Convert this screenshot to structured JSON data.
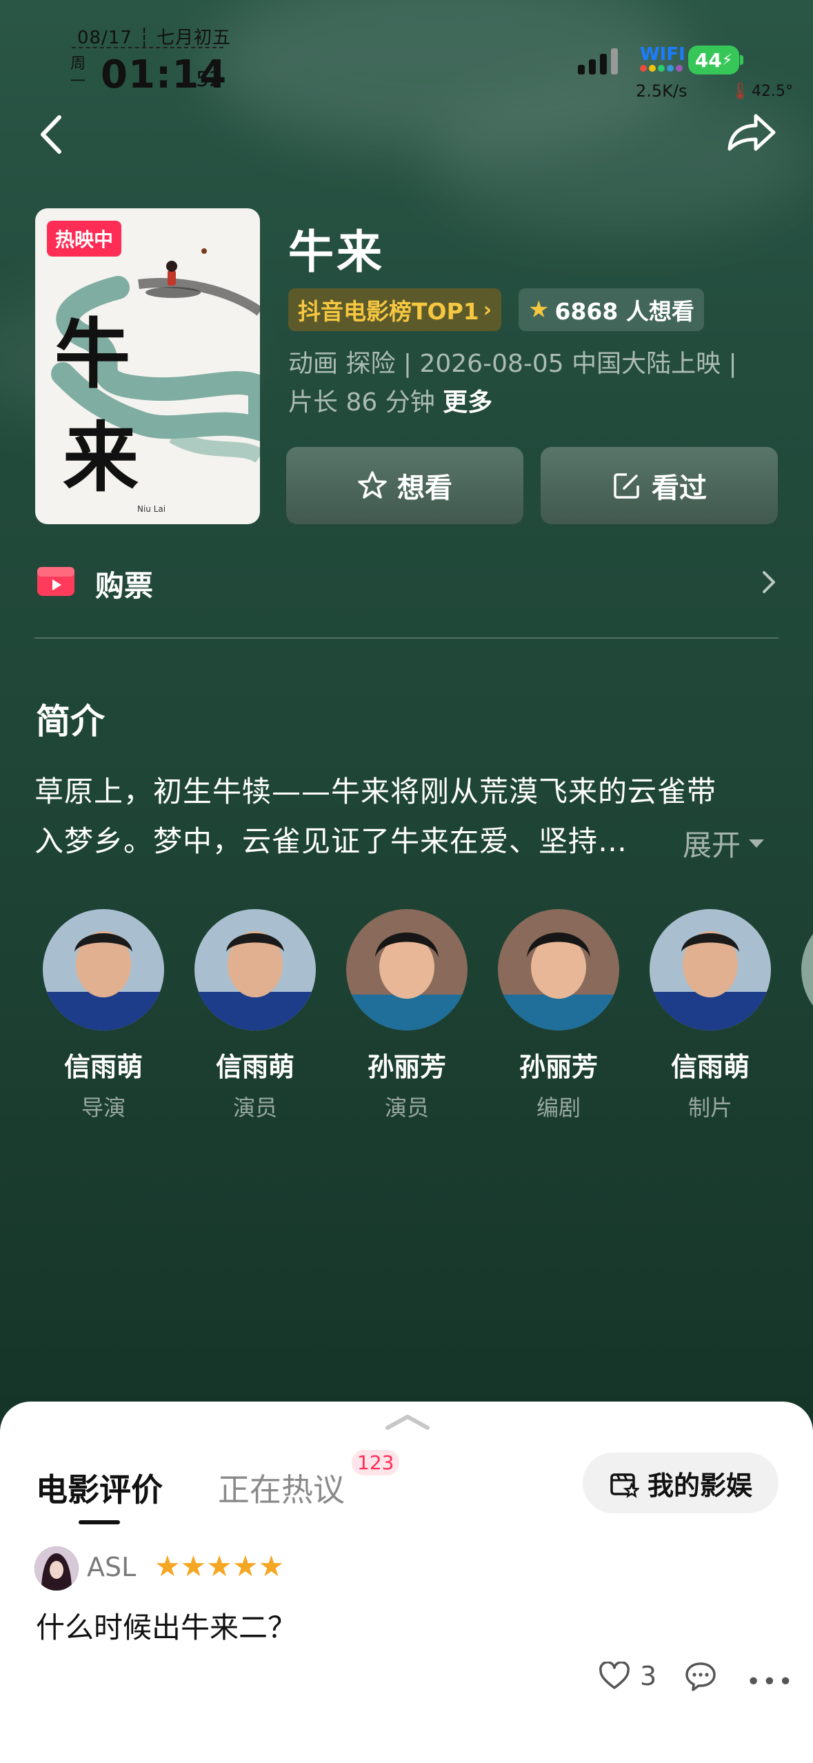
{
  "status_bar": {
    "date": "08/17 ┆ 七月初五",
    "weekday": "周一",
    "time": "01:14",
    "seconds": "52",
    "wifi_label": "WIFI",
    "battery": "44",
    "net_speed": "2.5K/s",
    "temperature": "42.5°"
  },
  "nav": {
    "back_icon": "chevron-left-icon",
    "share_icon": "share-arrow-icon"
  },
  "movie": {
    "status_badge": "热映中",
    "title": "牛来",
    "rank_badge": "抖音电影榜TOP1",
    "want_count": "6868 人想看",
    "meta_line1": "动画 探险 | 2026-08-05 中国大陆上映 |",
    "meta_line2_prefix": "片长 86 分钟",
    "meta_more": "更多",
    "poster_calligraphy": "牛来",
    "poster_caption": "Niu Lai"
  },
  "actions": {
    "want_label": "想看",
    "seen_label": "看过"
  },
  "buy": {
    "label": "购票"
  },
  "intro": {
    "heading": "简介",
    "line1": "草原上，初生牛犊——牛来将刚从荒漠飞来的云雀带",
    "line2": "入梦乡。梦中，云雀见证了牛来在爱、坚持…",
    "expand_label": "展开"
  },
  "cast": [
    {
      "name": "信雨萌",
      "role": "导演"
    },
    {
      "name": "信雨萌",
      "role": "演员"
    },
    {
      "name": "孙丽芳",
      "role": "演员"
    },
    {
      "name": "孙丽芳",
      "role": "编剧"
    },
    {
      "name": "信雨萌",
      "role": "制片"
    }
  ],
  "reviews": {
    "tab_reviews": "电影评价",
    "tab_hot": "正在热议",
    "hot_badge": "123",
    "my_ent_label": "我的影娱",
    "user_name": "ASL",
    "stars": "★★★★★",
    "comment": "什么时候出牛来二？",
    "likes": "3",
    "more_dots": "•••"
  },
  "colors": {
    "accent_red": "#ff2d55",
    "gold": "#f6c741",
    "battery_green": "#37c759"
  }
}
